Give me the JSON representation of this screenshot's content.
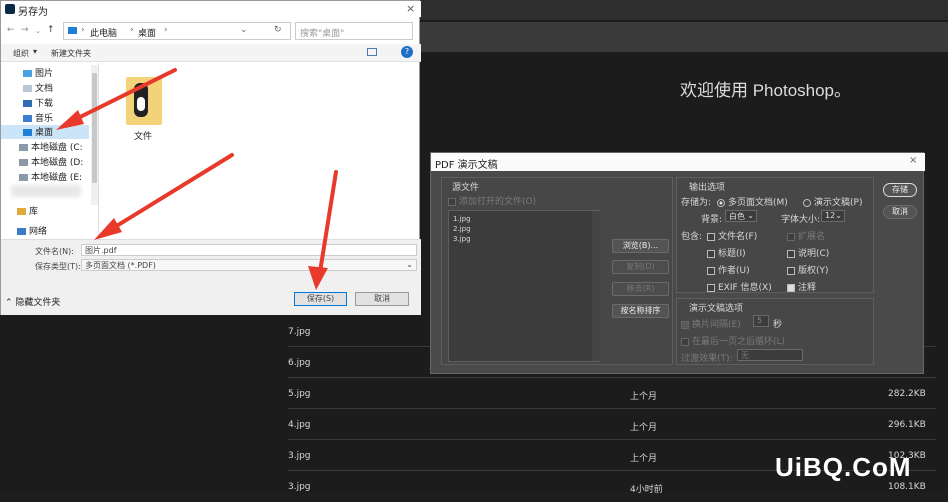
{
  "photoshop": {
    "welcome": "欢迎使用 Photoshop。",
    "files": [
      {
        "name": "7.jpg",
        "modified": "",
        "size": ""
      },
      {
        "name": "6.jpg",
        "modified": "",
        "size": ""
      },
      {
        "name": "5.jpg",
        "modified": "上个月",
        "size": "282.2KB"
      },
      {
        "name": "4.jpg",
        "modified": "上个月",
        "size": "296.1KB"
      },
      {
        "name": "3.jpg",
        "modified": "上个月",
        "size": "102.3KB"
      },
      {
        "name": "3.jpg",
        "modified": "4小时前",
        "size": "108.1KB"
      }
    ]
  },
  "save_dialog": {
    "title": "另存为",
    "breadcrumb": [
      "此电脑",
      "桌面"
    ],
    "search_placeholder": "搜索\"桌面\"",
    "organize": "组织",
    "new_folder": "新建文件夹",
    "nav_items": [
      "图片",
      "文档",
      "下载",
      "音乐",
      "桌面",
      "本地磁盘 (C:",
      "本地磁盘 (D:",
      "本地磁盘 (E:",
      "库",
      "网络"
    ],
    "folder_name": "文件",
    "filename_label": "文件名(N):",
    "filename_value": "图片.pdf",
    "type_label": "保存类型(T):",
    "type_value": "多页面文档 (*.PDF)",
    "hide_folders": "隐藏文件夹",
    "save_button": "保存(S)",
    "cancel_button": "取消"
  },
  "pdf_dialog": {
    "title": "PDF 演示文稿",
    "source_group": "源文件",
    "add_open_files": "添加打开的文件(O)",
    "source_files": [
      "1.jpg",
      "2.jpg",
      "3.jpg"
    ],
    "browse": "浏览(B)...",
    "duplicate": "复制(D)",
    "remove": "移去(R)",
    "sort_by_name": "按名称排序",
    "output_group": "输出选项",
    "save_as_label": "存储为:",
    "multipage": "多页面文档(M)",
    "presentation": "演示文稿(P)",
    "background_label": "背景:",
    "background_value": "白色",
    "font_size_label": "字体大小:",
    "font_size_value": "12",
    "include_label": "包含:",
    "filename_cb": "文件名(F)",
    "extension_cb": "扩展名",
    "title_cb": "标题(I)",
    "description_cb": "说明(C)",
    "author_cb": "作者(U)",
    "copyright_cb": "版权(Y)",
    "exif_cb": "EXIF 信息(X)",
    "notes_cb": "注释",
    "presentation_group": "演示文稿选项",
    "advance_every": "换片间隔(E)",
    "advance_value": "5",
    "seconds": "秒",
    "loop": "在最后一页之后循环(L)",
    "transition_label": "过渡效果(T):",
    "transition_value": "无",
    "ok_button": "存储",
    "cancel_button": "取消"
  },
  "watermark": "UiBQ.CoM"
}
